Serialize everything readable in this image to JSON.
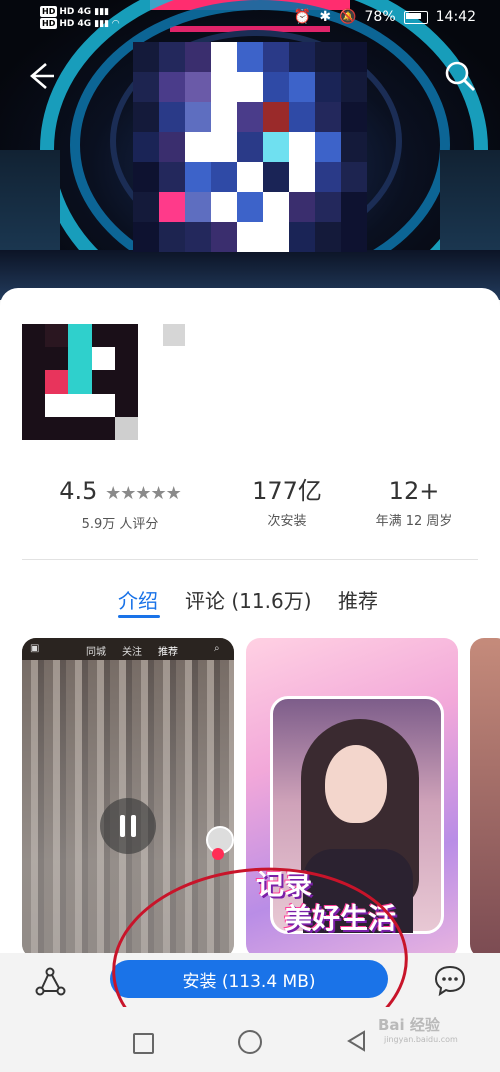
{
  "status_bar": {
    "left_line1": "HD 4G",
    "left_line2": "HD 4G",
    "battery": "78%",
    "time": "14:42"
  },
  "header": {
    "back_icon": "arrow-left-icon",
    "search_icon": "search-icon"
  },
  "stats": {
    "rating_value": "4.5",
    "rating_stars": "★★★★★",
    "rating_count": "5.9万 人评分",
    "installs_value": "177亿",
    "installs_label": "次安装",
    "age_value": "12+",
    "age_label": "年满 12 周岁"
  },
  "tabs": [
    {
      "label": "介绍",
      "active": true
    },
    {
      "label": "评论 (11.6万)",
      "active": false
    },
    {
      "label": "推荐",
      "active": false
    }
  ],
  "screenshot1_topbar": {
    "left": "同城",
    "middle": "关注",
    "right": "推荐"
  },
  "screenshot2": {
    "slogan_line1": "记录",
    "slogan_line2": "美好生活"
  },
  "bottom_bar": {
    "install_label": "安装 (113.4 MB)",
    "share_icon": "share-icon",
    "chat_icon": "chat-icon"
  },
  "watermark": {
    "text": "Bai 经验",
    "url": "jingyan.baidu.com"
  },
  "colors": {
    "accent": "#1a73e8",
    "annotation_red": "#c8142a"
  }
}
